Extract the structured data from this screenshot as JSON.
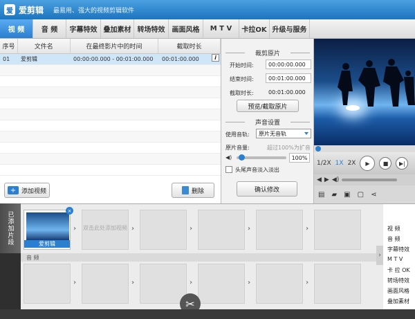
{
  "titlebar": {
    "icon_glyph": "爱",
    "title": "爱剪辑",
    "slogan": "最易用、强大的视频剪辑软件"
  },
  "tabs": [
    "视 频",
    "音 频",
    "字幕特效",
    "叠加素材",
    "转场特效",
    "画面风格",
    "M T V",
    "卡拉OK",
    "升级与服务"
  ],
  "clip_table": {
    "headers": [
      "序号",
      "文件名",
      "在最终影片中的时间",
      "截取时长"
    ],
    "rows": [
      {
        "index": "01",
        "name": "爱剪辑",
        "time_range": "00:00:00.000 - 00:01:00.000",
        "duration": "00:01:00.000",
        "info": "i"
      }
    ]
  },
  "left_buttons": {
    "add_video": "添加视频",
    "add_plus": "+",
    "delete": "删除"
  },
  "trim_panel": {
    "section_title": "裁剪原片",
    "start_label": "开始时间:",
    "start_value": "00:00:00.000",
    "end_label": "结束时间:",
    "end_value": "00:01:00.000",
    "dur_label": "截取时长:",
    "dur_value": "00:01:00.000",
    "preview_button": "预览/截取原片"
  },
  "sound_panel": {
    "section_title": "声音设置",
    "track_label": "使用音轨:",
    "track_value": "原片无音轨",
    "volume_label": "原片音量:",
    "volume_hint": "超过100%为扩音",
    "volume_value": "100%",
    "volume_level": 0.1,
    "fade_label": "头尾声音淡入淡出",
    "confirm_button": "确认修改"
  },
  "player": {
    "speed_half": "1/2X",
    "speed_1x": "1X",
    "speed_2x": "2X"
  },
  "timeline": {
    "side_tab": "已添加片段",
    "first_clip_name": "爱剪辑",
    "close_glyph": "×",
    "hint": "双击此处添加视频",
    "audio_label": "音 频",
    "expand_glyph": "›",
    "scissor_glyph": "✂"
  },
  "right_list": [
    "视 频",
    "音 频",
    "字幕特效",
    "M T V",
    "卡 拉 OK",
    "转场特效",
    "画面风格",
    "叠加素材"
  ],
  "colors": {
    "accent": "#2a7fd0",
    "titlebar": "#1d74bf"
  }
}
